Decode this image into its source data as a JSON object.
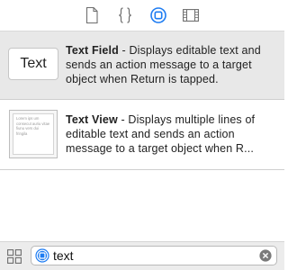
{
  "toolbar": {
    "tabs": [
      {
        "name": "file-template-library",
        "icon": "file-icon",
        "selected": false
      },
      {
        "name": "code-snippet-library",
        "icon": "braces-icon",
        "selected": false
      },
      {
        "name": "object-library",
        "icon": "object-library-icon",
        "selected": true
      },
      {
        "name": "media-library",
        "icon": "film-icon",
        "selected": false
      }
    ],
    "accent_color": "#1e7cf2"
  },
  "library": {
    "items": [
      {
        "thumbnail_text": "Text",
        "title": "Text Field",
        "description": " - Displays editable text and sends an action message to a target object when Return is tapped.",
        "selected": true
      },
      {
        "thumbnail_text": "Lorem ips um consecut auriu vitae fiunu vers dui fringila",
        "title": "Text View",
        "description": " - Displays multiple lines of editable text and sends an action message to a target object when R...",
        "selected": false
      }
    ]
  },
  "filter": {
    "view_toggle_icon": "grid-icon",
    "scope_icon": "object-library-icon",
    "value": "text",
    "clear_icon": "clear-icon"
  }
}
